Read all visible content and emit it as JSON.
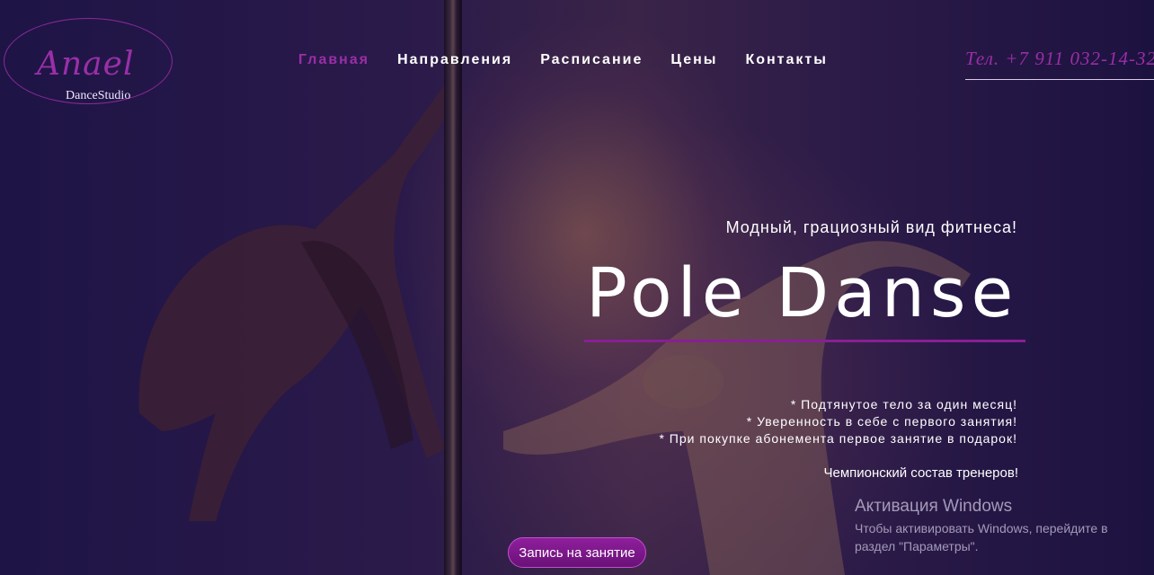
{
  "logo": {
    "script": "Anael",
    "subtitle": "DanceStudio"
  },
  "nav": [
    {
      "label": "Главная",
      "active": true
    },
    {
      "label": "Направления"
    },
    {
      "label": "Расписание"
    },
    {
      "label": "Цены"
    },
    {
      "label": "Контакты"
    }
  ],
  "phone": "Тел. +7 911 032-14-32",
  "hero": {
    "tagline": "Модный, грациозный вид фитнеса!",
    "title": "Pole Danse",
    "features": [
      "* Подтянутое тело за один месяц!",
      "* Уверенность в себе с первого занятия!",
      "* При покупке абонемента первое занятие в подарок!"
    ],
    "trainers": "Чемпионский состав тренеров!",
    "cta": "Запись на занятие"
  },
  "windows_watermark": {
    "title": "Активация Windows",
    "text": "Чтобы активировать Windows, перейдите в раздел \"Параметры\"."
  },
  "colors": {
    "accent": "#9b2ea6",
    "background": "#1c1240",
    "underline": "#8a1e96"
  }
}
